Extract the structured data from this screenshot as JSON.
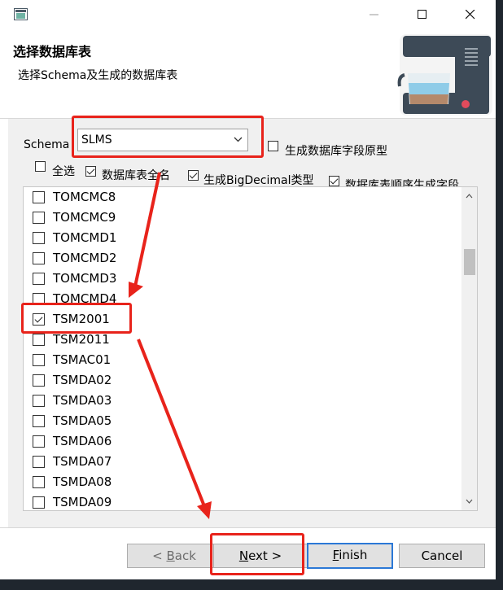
{
  "header": {
    "title": "选择数据库表",
    "subtitle": "选择Schema及生成的数据库表"
  },
  "schema": {
    "label": "Schema",
    "selected": "SLMS"
  },
  "options": {
    "select_all": {
      "label": "全选",
      "checked": false
    },
    "full_table_name": {
      "label": "数据库表全名",
      "checked": true
    },
    "prototype_fields": {
      "label": "生成数据库字段原型",
      "checked": false
    },
    "bigdecimal": {
      "label": "生成BigDecimal类型",
      "checked": true
    },
    "field_order": {
      "label": "数据库表顺序生成字段",
      "checked": true
    }
  },
  "tables": [
    {
      "name": "TOMCMC8",
      "checked": false
    },
    {
      "name": "TOMCMC9",
      "checked": false
    },
    {
      "name": "TOMCMD1",
      "checked": false
    },
    {
      "name": "TOMCMD2",
      "checked": false
    },
    {
      "name": "TOMCMD3",
      "checked": false
    },
    {
      "name": "TOMCMD4",
      "checked": false
    },
    {
      "name": "TSM2001",
      "checked": true
    },
    {
      "name": "TSM2011",
      "checked": false
    },
    {
      "name": "TSMAC01",
      "checked": false
    },
    {
      "name": "TSMDA02",
      "checked": false
    },
    {
      "name": "TSMDA03",
      "checked": false
    },
    {
      "name": "TSMDA05",
      "checked": false
    },
    {
      "name": "TSMDA06",
      "checked": false
    },
    {
      "name": "TSMDA07",
      "checked": false
    },
    {
      "name": "TSMDA08",
      "checked": false
    },
    {
      "name": "TSMDA09",
      "checked": false
    }
  ],
  "buttons": {
    "back": {
      "mnemonic": "B",
      "rest": "ack",
      "prefix": "< "
    },
    "next": {
      "mnemonic": "N",
      "rest": "ext",
      "suffix": " >"
    },
    "finish": {
      "mnemonic": "F",
      "rest": "inish"
    },
    "cancel": {
      "label": "Cancel"
    }
  },
  "colors": {
    "highlight": "#e8231b",
    "default_button_border": "#2b78d6"
  }
}
